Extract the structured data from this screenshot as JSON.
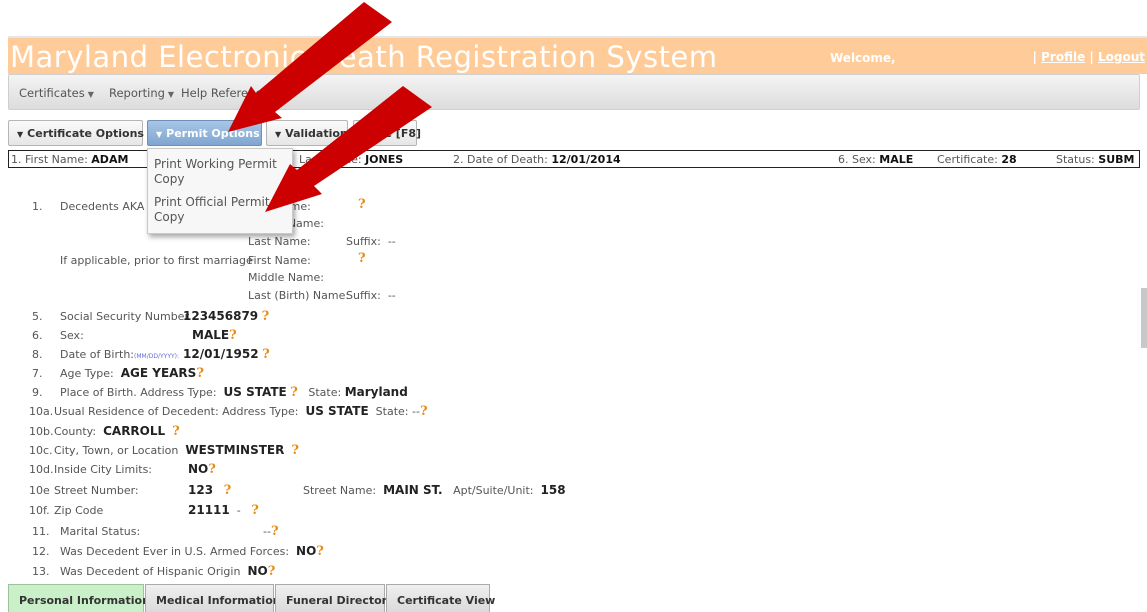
{
  "header": {
    "title": "Maryland Electronic Death Registration System",
    "welcome": "Welcome,",
    "separator1": "|",
    "profile": "Profile",
    "separator2": "|",
    "logout": "Logout"
  },
  "menu": {
    "items": [
      {
        "label": "Certificates"
      },
      {
        "label": "Reporting"
      },
      {
        "label": "Help Reference"
      }
    ]
  },
  "toolbar": {
    "certificate_options": "Certificate Options",
    "permit_options": "Permit Options",
    "validation": "Validation",
    "save": "Save [F8]"
  },
  "dropdown": {
    "items": [
      {
        "label": "Print Working Permit Copy"
      },
      {
        "label": "Print Official Permit Copy"
      }
    ]
  },
  "infobar": {
    "first_name_label": "1. First Name:",
    "first_name": "ADAM",
    "last_name_label": "Last Name:",
    "last_name": "JONES",
    "dod_label": "2. Date of Death:",
    "dod": "12/01/2014",
    "sex_label": "6. Sex:",
    "sex": "MALE",
    "certificate_label": "Certificate:",
    "certificate": "28",
    "status_label": "Status:",
    "status": "SUBM"
  },
  "form": {
    "aka": {
      "num": "1.",
      "label": "Decedents AKA if",
      "first_name": "First Name:",
      "middle_name": "Middle Name:",
      "last_name": "Last Name:",
      "suffix": "Suffix:",
      "suffix_value": "--"
    },
    "prior_marriage": {
      "label": "If applicable, prior to first marriage",
      "first_name": "First Name:",
      "middle_name": "Middle Name:",
      "last_birth_name": "Last (Birth) Name:",
      "suffix": "Suffix:",
      "suffix_value": "--"
    },
    "ssn": {
      "num": "5.",
      "label": "Social Security Number",
      "value": "123456879"
    },
    "sex": {
      "num": "6.",
      "label": "Sex:",
      "value": "MALE"
    },
    "dob": {
      "num": "8.",
      "label": "Date of Birth:",
      "format": "(MM/DD/YYYY):",
      "value": "12/01/1952"
    },
    "age_type": {
      "num": "7.",
      "label": "Age Type:",
      "value": "AGE YEARS"
    },
    "birthplace": {
      "num": "9.",
      "label": "Place of Birth. Address Type:",
      "value": "US STATE",
      "state_label": "State:",
      "state": "Maryland"
    },
    "residence": {
      "num": "10a.",
      "label": "Usual Residence of Decedent: Address Type:",
      "value": "US STATE",
      "state_label": "State:",
      "state": "--"
    },
    "county": {
      "num": "10b.",
      "label": "County:",
      "value": "CARROLL"
    },
    "city": {
      "num": "10c.",
      "label": "City, Town, or Location",
      "value": "WESTMINSTER"
    },
    "city_limits": {
      "num": "10d.",
      "label": "Inside City Limits:",
      "value": "NO"
    },
    "street": {
      "num": "10e",
      "label": "Street Number:",
      "value": "123",
      "street_name_label": "Street Name:",
      "street_name": "MAIN ST.",
      "apt_label": "Apt/Suite/Unit:",
      "apt": "158"
    },
    "zip": {
      "num": "10f.",
      "label": "Zip Code",
      "value": "21111",
      "dash": "-"
    },
    "marital": {
      "num": "11.",
      "label": "Marital Status:",
      "value": "--"
    },
    "armed_forces": {
      "num": "12.",
      "label": "Was Decedent Ever in U.S. Armed Forces:",
      "value": "NO"
    },
    "hispanic": {
      "num": "13.",
      "label": "Was Decedent of Hispanic Origin",
      "value": "NO"
    }
  },
  "help_icon": "?",
  "tabs": [
    {
      "label": "Personal Information"
    },
    {
      "label": "Medical Information"
    },
    {
      "label": "Funeral Director"
    },
    {
      "label": "Certificate View"
    }
  ],
  "icons": {
    "caret": "caret-down-icon",
    "help": "help-question-icon",
    "arrow": "red-pointer-arrow"
  },
  "colors": {
    "banner": "#ffcc99",
    "active_button": "#7fa6d0",
    "help_icon": "#e88b17",
    "arrow": "#cc0000",
    "active_tab": "#c9f0c9"
  }
}
